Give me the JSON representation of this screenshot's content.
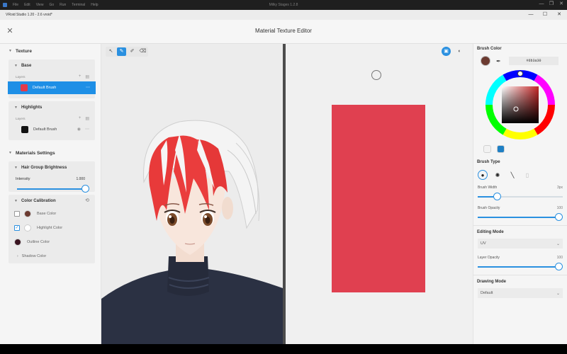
{
  "os": {
    "menu": [
      "File",
      "Edit",
      "View",
      "Go",
      "Run",
      "Terminal",
      "Help"
    ],
    "window_title": "Milky Stages 1.2.8",
    "controls": [
      "—",
      "❐",
      "✕"
    ]
  },
  "app": {
    "name": "VRoid Studio 1.20 - 2.6 vroid*",
    "controls": [
      "—",
      "☐",
      "✕"
    ]
  },
  "dialog": {
    "title": "Material Texture Editor"
  },
  "left": {
    "texture_header": "Texture",
    "base": {
      "title": "Base",
      "layers_label": "Layers",
      "layer_name": "Default Brush",
      "layer_color": "#e33a4a"
    },
    "highlights": {
      "title": "Highlights",
      "layers_label": "Layers",
      "layer_name": "Default Brush",
      "layer_color": "#111111"
    },
    "material_settings_header": "Materials Settings",
    "hair_group": {
      "title": "Hair Group Brightness",
      "intensity_label": "Intensity",
      "intensity_value": "1.000",
      "intensity_fraction": 1.0
    },
    "color_calibration": {
      "title": "Color Calibration",
      "items": [
        {
          "label": "Base Color",
          "checked": false,
          "color": "#6b3a30"
        },
        {
          "label": "Highlight Color",
          "checked": true,
          "color": "#ffffff"
        },
        {
          "label": "Outline Color",
          "checked": false,
          "color": "#3a1420"
        }
      ]
    },
    "shadow_color_label": "Shadow Color"
  },
  "viewport": {
    "tools": [
      "↖",
      "✎",
      "✐",
      "⌫"
    ],
    "active_tool_index": 1,
    "view_icons": [
      "▣",
      "◐"
    ]
  },
  "texture": {
    "fill_color": "#e04050"
  },
  "right": {
    "brush_color_label": "Brush Color",
    "current_color": "#6b3a30",
    "hex_value": "#6b3a30",
    "swatches": [
      "#f2f2f2",
      "#1e7fc4"
    ],
    "brush_type_label": "Brush Type",
    "brush_width_label": "Brush Width",
    "brush_width_value": "3px",
    "brush_width_fraction": 0.2,
    "brush_opacity_label": "Brush Opacity",
    "brush_opacity_value": "100",
    "brush_opacity_fraction": 1.0,
    "editing_mode_label": "Editing Mode",
    "editing_mode_value": "UV",
    "layer_opacity_label": "Layer Opacity",
    "layer_opacity_value": "100",
    "layer_opacity_fraction": 1.0,
    "drawing_mode_label": "Drawing Mode",
    "drawing_mode_value": "Default"
  }
}
